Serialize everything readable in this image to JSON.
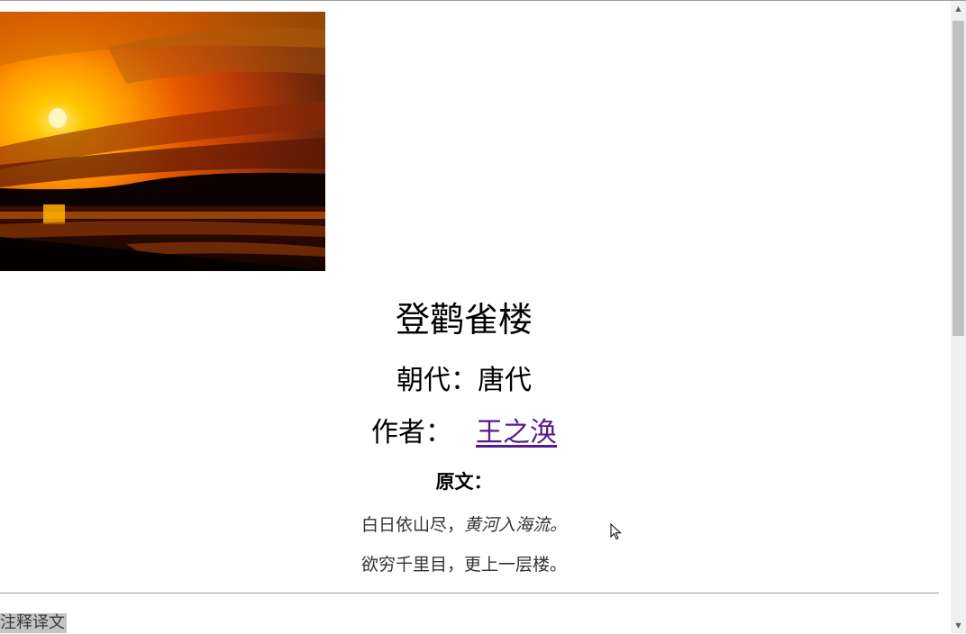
{
  "poem": {
    "title": "登鹳雀楼",
    "dynasty_label": "朝代：",
    "dynasty": "唐代",
    "author_label": "作者：",
    "author": "王之涣",
    "original_label": "原文：",
    "lines": [
      {
        "plain": "白日依山尽，",
        "italic": "黄河入海流。"
      },
      {
        "plain": "欲穷千里目，更上一层楼。",
        "italic": ""
      }
    ]
  },
  "footer": {
    "translation_tab": "注释译文"
  },
  "icons": {
    "scroll_up": "scroll-up-arrow-icon",
    "scroll_down": "scroll-down-arrow-icon",
    "cursor": "mouse-pointer-icon"
  },
  "colors": {
    "link_visited": "#551a8b",
    "tab_highlight": "#c4c4c4",
    "scroll_thumb": "#c1c1c1"
  }
}
